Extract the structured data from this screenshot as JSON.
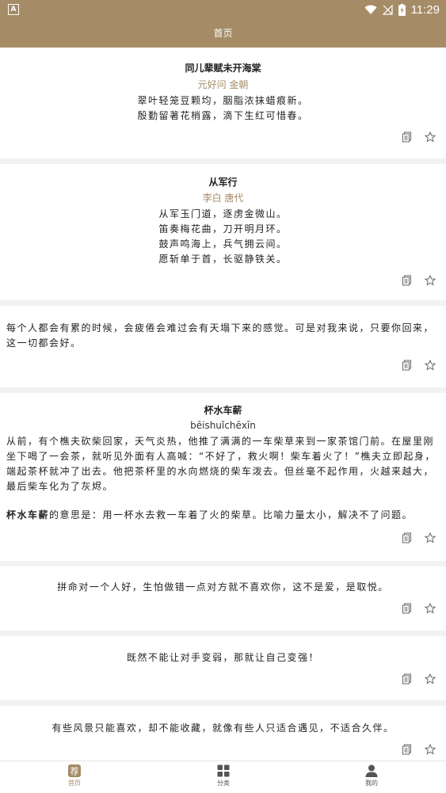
{
  "status_bar": {
    "app_badge": "A",
    "time": "11:29"
  },
  "header": {
    "title": "首页"
  },
  "feed": {
    "card1": {
      "title": "同儿辈赋未开海棠",
      "author": "元好问  金朝",
      "lines": [
        "翠叶轻笼豆颗均，胭脂浓抹蜡痕新。",
        "殷勤留著花梢露，滴下生红可惜春。"
      ]
    },
    "card2": {
      "title": "从军行",
      "author": "李白  唐代",
      "lines": [
        "从军玉门道，逐虏金微山。",
        "笛奏梅花曲，刀开明月环。",
        "鼓声鸣海上，兵气拥云间。",
        "愿斩单于首，长驱静铁关。"
      ]
    },
    "card3": {
      "text": "每个人都会有累的时候，会疲倦会难过会有天塌下来的感觉。可是对我来说，只要你回来，这一切都会好。"
    },
    "card4": {
      "title": "杯水车薪",
      "pinyin": "bēishuǐchēxīn",
      "story": "从前，有个樵夫砍柴回家，天气炎热，他推了满满的一车柴草来到一家茶馆门前。在屋里刚坐下喝了一会茶，就听见外面有人高喊：“不好了，救火啊！柴车着火了！”樵夫立即起身，端起茶杯就冲了出去。他把茶杯里的水向燃烧的柴车泼去。但丝毫不起作用，火越来越大，最后柴车化为了灰烬。",
      "meaning_term": "杯水车薪",
      "meaning": "的意思是：用一杯水去救一车着了火的柴草。比喻力量太小，解决不了问题。"
    },
    "card5": {
      "text": "拼命对一个人好，生怕做错一点对方就不喜欢你，这不是爱，是取悦。"
    },
    "card6": {
      "text": "既然不能让对手变弱，那就让自己变强！"
    },
    "card7": {
      "text": "有些风景只能喜欢，却不能收藏，就像有些人只适合遇见，不适合久伴。"
    }
  },
  "card_actions": {
    "copy_icon": "copy-icon",
    "favorite_icon": "star-outline-icon"
  },
  "bottom_nav": {
    "items": [
      {
        "label": "首页",
        "icon_text": "荐",
        "icon": "recommend-icon",
        "active": true
      },
      {
        "label": "分类",
        "icon": "grid-icon",
        "active": false
      },
      {
        "label": "我的",
        "icon": "person-icon",
        "active": false
      }
    ]
  },
  "colors": {
    "accent": "#a58b66",
    "background": "#f2f2f2",
    "card": "#ffffff",
    "text": "#222222"
  }
}
